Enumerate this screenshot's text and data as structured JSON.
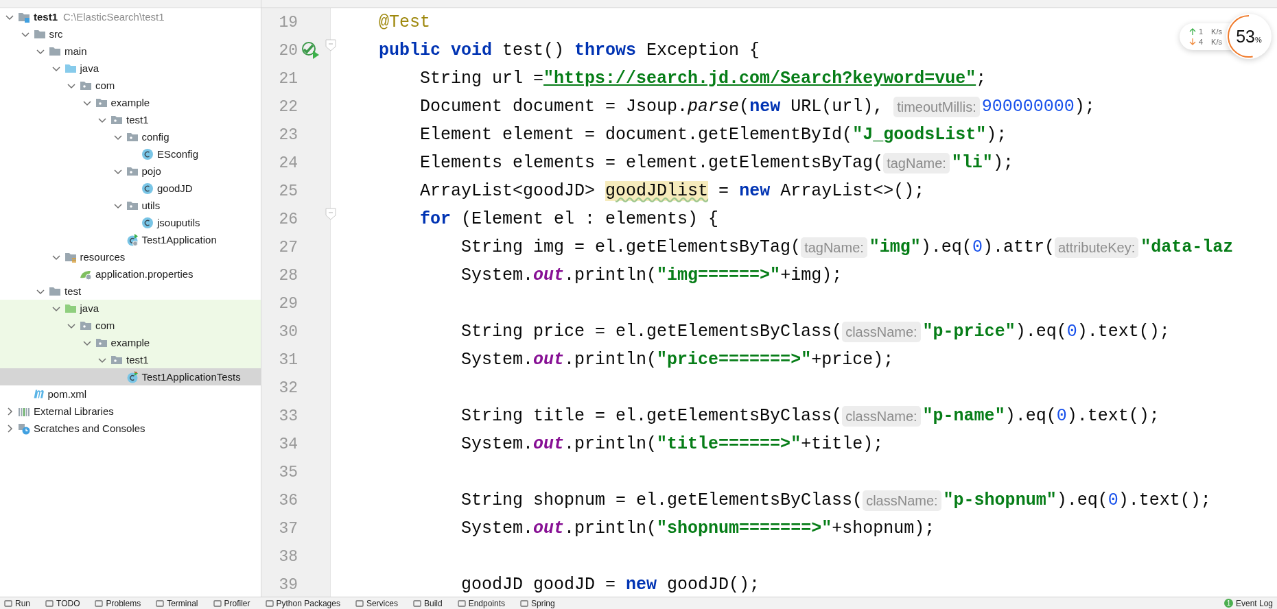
{
  "project_tree": [
    {
      "label": "test1",
      "path": "C:\\ElasticSearch\\test1",
      "kind": "module",
      "expanded": true,
      "selected": false,
      "children": [
        {
          "label": "src",
          "kind": "folder",
          "expanded": true,
          "selected": false,
          "children": [
            {
              "label": "main",
              "kind": "folder",
              "expanded": true,
              "selected": false,
              "children": [
                {
                  "label": "java",
                  "kind": "source-root",
                  "expanded": true,
                  "selected": false,
                  "children": [
                    {
                      "label": "com",
                      "kind": "package",
                      "expanded": true,
                      "selected": false,
                      "children": [
                        {
                          "label": "example",
                          "kind": "package",
                          "expanded": true,
                          "selected": false,
                          "children": [
                            {
                              "label": "test1",
                              "kind": "package",
                              "expanded": true,
                              "selected": false,
                              "children": [
                                {
                                  "label": "config",
                                  "kind": "package",
                                  "expanded": true,
                                  "selected": false,
                                  "children": [
                                    {
                                      "label": "ESconfig",
                                      "kind": "class",
                                      "selected": false
                                    }
                                  ]
                                },
                                {
                                  "label": "pojo",
                                  "kind": "package",
                                  "expanded": true,
                                  "selected": false,
                                  "children": [
                                    {
                                      "label": "goodJD",
                                      "kind": "class",
                                      "selected": false
                                    }
                                  ]
                                },
                                {
                                  "label": "utils",
                                  "kind": "package",
                                  "expanded": true,
                                  "selected": false,
                                  "children": [
                                    {
                                      "label": "jsouputils",
                                      "kind": "class",
                                      "selected": false
                                    }
                                  ]
                                },
                                {
                                  "label": "Test1Application",
                                  "kind": "app-class",
                                  "selected": false
                                }
                              ]
                            }
                          ]
                        }
                      ]
                    }
                  ]
                },
                {
                  "label": "resources",
                  "kind": "resources",
                  "expanded": true,
                  "selected": false,
                  "children": [
                    {
                      "label": "application.properties",
                      "kind": "properties",
                      "selected": false
                    }
                  ]
                }
              ]
            },
            {
              "label": "test",
              "kind": "folder",
              "expanded": true,
              "selected": false,
              "children": [
                {
                  "label": "java",
                  "kind": "test-root",
                  "expanded": true,
                  "selected": false,
                  "children": [
                    {
                      "label": "com",
                      "kind": "package",
                      "expanded": true,
                      "selected": false,
                      "children": [
                        {
                          "label": "example",
                          "kind": "package",
                          "expanded": true,
                          "selected": false,
                          "children": [
                            {
                              "label": "test1",
                              "kind": "package",
                              "expanded": true,
                              "selected": false,
                              "children": [
                                {
                                  "label": "Test1ApplicationTests",
                                  "kind": "test-class",
                                  "selected": true
                                }
                              ]
                            }
                          ]
                        }
                      ]
                    }
                  ]
                }
              ]
            }
          ]
        },
        {
          "label": "pom.xml",
          "kind": "pom",
          "selected": false
        }
      ]
    },
    {
      "label": "External Libraries",
      "kind": "libraries",
      "expanded": false,
      "selected": false
    },
    {
      "label": "Scratches and Consoles",
      "kind": "scratches",
      "expanded": false,
      "selected": false
    }
  ],
  "editor": {
    "lines": [
      {
        "number": "19",
        "run": false,
        "fold": false,
        "tokens": [
          {
            "kind": "annotation",
            "text": "    @Test"
          }
        ]
      },
      {
        "number": "20",
        "run": true,
        "fold": true,
        "tokens": [
          {
            "kind": "keyword",
            "text": "    public void"
          },
          {
            "kind": "plain",
            "text": " test() "
          },
          {
            "kind": "keyword",
            "text": "throws"
          },
          {
            "kind": "plain",
            "text": " Exception {"
          }
        ]
      },
      {
        "number": "21",
        "run": false,
        "fold": false,
        "tokens": [
          {
            "kind": "plain",
            "text": "        String url ="
          },
          {
            "kind": "url",
            "text": "\"https://search.jd.com/Search?keyword=vue\""
          },
          {
            "kind": "plain",
            "text": ";"
          }
        ]
      },
      {
        "number": "22",
        "run": false,
        "fold": false,
        "tokens": [
          {
            "kind": "plain",
            "text": "        Document document = Jsoup."
          },
          {
            "kind": "static-method",
            "text": "parse"
          },
          {
            "kind": "plain",
            "text": "("
          },
          {
            "kind": "keyword",
            "text": "new"
          },
          {
            "kind": "plain",
            "text": " URL(url), "
          },
          {
            "kind": "hint",
            "text": "timeoutMillis:"
          },
          {
            "kind": "number",
            "text": "900000000"
          },
          {
            "kind": "plain",
            "text": ");"
          }
        ]
      },
      {
        "number": "23",
        "run": false,
        "fold": false,
        "tokens": [
          {
            "kind": "plain",
            "text": "        Element element = document.getElementById("
          },
          {
            "kind": "string",
            "text": "\"J_goodsList\""
          },
          {
            "kind": "plain",
            "text": ");"
          }
        ]
      },
      {
        "number": "24",
        "run": false,
        "fold": false,
        "tokens": [
          {
            "kind": "plain",
            "text": "        Elements elements = element.getElementsByTag("
          },
          {
            "kind": "hint",
            "text": "tagName:"
          },
          {
            "kind": "string",
            "text": "\"li\""
          },
          {
            "kind": "plain",
            "text": ");"
          }
        ]
      },
      {
        "number": "25",
        "run": false,
        "fold": false,
        "tokens": [
          {
            "kind": "plain",
            "text": "        ArrayList<goodJD> "
          },
          {
            "kind": "highlight",
            "text": "goodJDlist"
          },
          {
            "kind": "plain",
            "text": " = "
          },
          {
            "kind": "keyword",
            "text": "new"
          },
          {
            "kind": "plain",
            "text": " ArrayList<>();"
          }
        ]
      },
      {
        "number": "26",
        "run": false,
        "fold": true,
        "tokens": [
          {
            "kind": "keyword",
            "text": "        for"
          },
          {
            "kind": "plain",
            "text": " (Element el : elements) {"
          }
        ]
      },
      {
        "number": "27",
        "run": false,
        "fold": false,
        "tokens": [
          {
            "kind": "plain",
            "text": "            String img = el.getElementsByTag("
          },
          {
            "kind": "hint",
            "text": "tagName:"
          },
          {
            "kind": "string",
            "text": "\"img\""
          },
          {
            "kind": "plain",
            "text": ").eq("
          },
          {
            "kind": "number",
            "text": "0"
          },
          {
            "kind": "plain",
            "text": ").attr("
          },
          {
            "kind": "hint",
            "text": "attributeKey:"
          },
          {
            "kind": "string",
            "text": "\"data-laz"
          }
        ]
      },
      {
        "number": "28",
        "run": false,
        "fold": false,
        "tokens": [
          {
            "kind": "plain",
            "text": "            System."
          },
          {
            "kind": "static-field",
            "text": "out"
          },
          {
            "kind": "plain",
            "text": ".println("
          },
          {
            "kind": "string",
            "text": "\"img======>\""
          },
          {
            "kind": "plain",
            "text": "+img);"
          }
        ]
      },
      {
        "number": "29",
        "run": false,
        "fold": false
      },
      {
        "number": "30",
        "run": false,
        "fold": false,
        "tokens": [
          {
            "kind": "plain",
            "text": "            String price = el.getElementsByClass("
          },
          {
            "kind": "hint",
            "text": "className:"
          },
          {
            "kind": "string",
            "text": "\"p-price\""
          },
          {
            "kind": "plain",
            "text": ").eq("
          },
          {
            "kind": "number",
            "text": "0"
          },
          {
            "kind": "plain",
            "text": ").text();"
          }
        ]
      },
      {
        "number": "31",
        "run": false,
        "fold": false,
        "tokens": [
          {
            "kind": "plain",
            "text": "            System."
          },
          {
            "kind": "static-field",
            "text": "out"
          },
          {
            "kind": "plain",
            "text": ".println("
          },
          {
            "kind": "string",
            "text": "\"price=======>\""
          },
          {
            "kind": "plain",
            "text": "+price);"
          }
        ]
      },
      {
        "number": "32",
        "run": false,
        "fold": false
      },
      {
        "number": "33",
        "run": false,
        "fold": false,
        "tokens": [
          {
            "kind": "plain",
            "text": "            String title = el.getElementsByClass("
          },
          {
            "kind": "hint",
            "text": "className:"
          },
          {
            "kind": "string",
            "text": "\"p-name\""
          },
          {
            "kind": "plain",
            "text": ").eq("
          },
          {
            "kind": "number",
            "text": "0"
          },
          {
            "kind": "plain",
            "text": ").text();"
          }
        ]
      },
      {
        "number": "34",
        "run": false,
        "fold": false,
        "tokens": [
          {
            "kind": "plain",
            "text": "            System."
          },
          {
            "kind": "static-field",
            "text": "out"
          },
          {
            "kind": "plain",
            "text": ".println("
          },
          {
            "kind": "string",
            "text": "\"title======>\""
          },
          {
            "kind": "plain",
            "text": "+title);"
          }
        ]
      },
      {
        "number": "35",
        "run": false,
        "fold": false
      },
      {
        "number": "36",
        "run": false,
        "fold": false,
        "tokens": [
          {
            "kind": "plain",
            "text": "            String shopnum = el.getElementsByClass("
          },
          {
            "kind": "hint",
            "text": "className:"
          },
          {
            "kind": "string",
            "text": "\"p-shopnum\""
          },
          {
            "kind": "plain",
            "text": ").eq("
          },
          {
            "kind": "number",
            "text": "0"
          },
          {
            "kind": "plain",
            "text": ").text();"
          }
        ]
      },
      {
        "number": "37",
        "run": false,
        "fold": false,
        "tokens": [
          {
            "kind": "plain",
            "text": "            System."
          },
          {
            "kind": "static-field",
            "text": "out"
          },
          {
            "kind": "plain",
            "text": ".println("
          },
          {
            "kind": "string",
            "text": "\"shopnum=======>\""
          },
          {
            "kind": "plain",
            "text": "+shopnum);"
          }
        ]
      },
      {
        "number": "38",
        "run": false,
        "fold": false
      },
      {
        "number": "39",
        "run": false,
        "fold": false,
        "tokens": [
          {
            "kind": "plain",
            "text": "            goodJD goodJD = "
          },
          {
            "kind": "keyword",
            "text": "new"
          },
          {
            "kind": "plain",
            "text": " goodJD();"
          }
        ]
      }
    ]
  },
  "speed_widget": {
    "upload": {
      "value": "1",
      "unit": "K/s"
    },
    "download": {
      "value": "4",
      "unit": "K/s"
    },
    "usage": "53",
    "usage_unit": "%",
    "level": 0.53
  },
  "tool_windows": [
    {
      "label": "Run"
    },
    {
      "label": "TODO"
    },
    {
      "label": "Problems"
    },
    {
      "label": "Terminal"
    },
    {
      "label": "Profiler"
    },
    {
      "label": "Python Packages"
    },
    {
      "label": "Services"
    },
    {
      "label": "Build"
    },
    {
      "label": "Endpoints"
    },
    {
      "label": "Spring"
    }
  ],
  "event_log": {
    "label": "Event Log",
    "badge": "1"
  }
}
